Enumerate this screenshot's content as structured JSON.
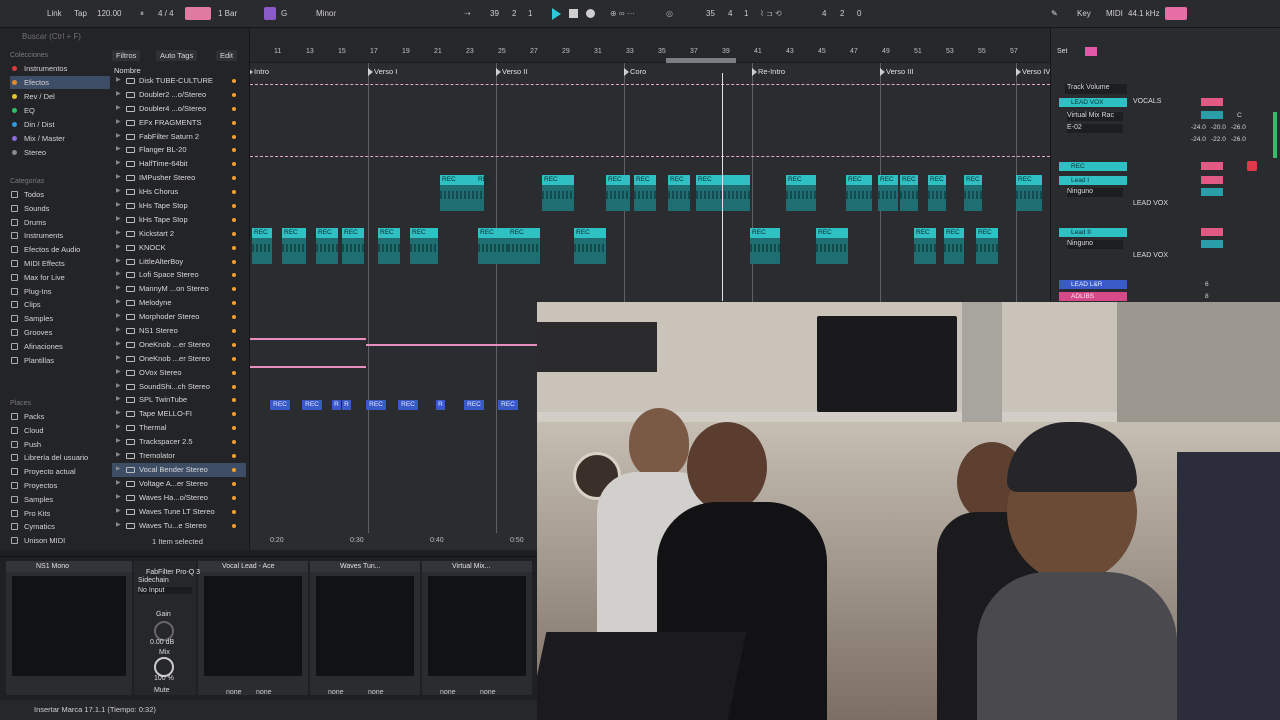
{
  "transport": {
    "link": "Link",
    "tap": "Tap",
    "tempo": "120.00",
    "signature": "4 / 4",
    "quantize": "1 Bar",
    "key_root": "G",
    "scale": "Minor",
    "position_bar": "39",
    "position_beat": "2",
    "position_sixteenth": "1",
    "loop_start_bar": "35",
    "loop_start_beat": "4",
    "loop_start_sixteenth": "1",
    "loop_length_bar": "4",
    "loop_length_beat": "2",
    "loop_length_sixteenth": "0",
    "key_label": "Key",
    "midi_label": "MIDI",
    "sample_rate": "44.1 kHz"
  },
  "browser": {
    "search_placeholder": "Buscar (Ctrl + F)",
    "colecciones_label": "Colecciones",
    "collections": [
      {
        "label": "Instrumentos",
        "color": "#e23a3a"
      },
      {
        "label": "Efectos",
        "color": "#e5882a"
      },
      {
        "label": "Rev / Del",
        "color": "#e5c52a"
      },
      {
        "label": "EQ",
        "color": "#2fbf6a"
      },
      {
        "label": "Din / Dist",
        "color": "#2a9be0"
      },
      {
        "label": "Mix / Master",
        "color": "#8a6ae0"
      },
      {
        "label": "Stereo",
        "color": "#8a8a8a"
      }
    ],
    "categorias_label": "Categorías",
    "categories": [
      "Todos",
      "Sounds",
      "Drums",
      "Instruments",
      "Efectos de Audio",
      "MIDI Effects",
      "Max for Live",
      "Plug-Ins",
      "Clips",
      "Samples",
      "Grooves",
      "Afinaciones",
      "Plantillas"
    ],
    "places_label": "Places",
    "places": [
      "Packs",
      "Cloud",
      "Push",
      "Librería del usuario",
      "Proyecto actual",
      "Proyectos",
      "Samples",
      "Pro Kits",
      "Cymatics",
      "Unison MIDI"
    ],
    "filter_label": "Filtros",
    "auto_tags_label": "Auto Tags",
    "edit_label": "Edit",
    "name_header": "Nombre",
    "files": [
      "Disk TUBE-CULTURE",
      "Doubler2 ...o/Stereo",
      "Doubler4 ...o/Stereo",
      "EFx FRAGMENTS",
      "FabFilter Saturn 2",
      "Flanger BL-20",
      "HalfTime-64bit",
      "IMPusher Stereo",
      "kHs Chorus",
      "kHs Tape Stop",
      "kHs Tape Stop",
      "Kickstart 2",
      "KNOCK",
      "LittleAlterBoy",
      "Lofi Space Stereo",
      "MannyM ...on Stereo",
      "Melodyne",
      "Morphoder Stereo",
      "NS1 Stereo",
      "OneKnob ...er Stereo",
      "OneKnob ...er Stereo",
      "OVox Stereo",
      "SoundShi...ch Stereo",
      "SPL TwinTube",
      "Tape MELLO-FI",
      "Thermal",
      "Trackspacer 2.5",
      "Tremolator",
      "Vocal Bender Stereo",
      "Voltage A...er Stereo",
      "Waves Ha...o/Stereo",
      "Waves Tune LT Stereo",
      "Waves Tu...e Stereo"
    ],
    "selected_file_index": 28,
    "selection_status": "1 Item selected"
  },
  "arrangement": {
    "bar_numbers": [
      "11",
      "13",
      "15",
      "17",
      "19",
      "21",
      "23",
      "25",
      "27",
      "29",
      "31",
      "33",
      "35",
      "37",
      "39",
      "41",
      "43",
      "45",
      "47",
      "49",
      "51",
      "53",
      "55",
      "57"
    ],
    "locators": [
      "Intro",
      "Verso I",
      "Verso II",
      "Coro",
      "Re-Intro",
      "Verso III",
      "Verso IV"
    ],
    "clip_label": "REC",
    "blue_clip_labels": [
      "REC",
      "REC",
      "R",
      "R",
      "REC",
      "REC",
      "R",
      "REC",
      "REC"
    ],
    "timecodes": [
      "0:20",
      "0:30",
      "0:40",
      "0:50"
    ]
  },
  "mixer": {
    "set_label": "Set",
    "track_volume": "Track Volume",
    "tracks": [
      {
        "name": "LEAD VOX",
        "output": "VOCALS",
        "num": "7",
        "vol": "0",
        "pan": "C"
      },
      {
        "name": "REC",
        "num": "3"
      },
      {
        "name": "Lead I",
        "num": "4",
        "vol": "0",
        "pan": "C",
        "input": "Ninguno",
        "output": "LEAD VOX"
      },
      {
        "name": "Lead II",
        "num": "5",
        "vol": "0",
        "pan": "C",
        "input": "Ninguno",
        "output": "LEAD VOX"
      },
      {
        "name": "LEAD L&R",
        "num": "6"
      },
      {
        "name": "ADLIBS",
        "num": "8"
      }
    ],
    "device": "Virtual Mix Rac",
    "preset": "E-02",
    "sends": [
      "-24.0",
      "-20.0",
      "-26.0"
    ],
    "sends_b": [
      "-24.0",
      "-22.0",
      "-26.0"
    ],
    "solo_label": "S"
  },
  "devices": [
    {
      "title": "NS1 Mono",
      "sel1": "",
      "sel2": ""
    },
    {
      "title": "FabFilter Pro-Q 3",
      "sel1": "none",
      "sel2": "none"
    },
    {
      "title": "Waves Tun...",
      "sel1": "none",
      "sel2": "none"
    },
    {
      "title": "Virtual Mix...",
      "sel1": "none",
      "sel2": "none"
    }
  ],
  "chain": {
    "sidechain_label": "Sidechain",
    "sidechain_input": "No Input",
    "gain_label": "Gain",
    "gain_value": "0.00 dB",
    "mix_label": "Mix",
    "mix_value": "100 %",
    "mute_label": "Mute",
    "preset_name": "Vocal Lead - Ace",
    "chain_sel1": "none",
    "chain_sel2": "none"
  },
  "status_message": "Insertar Marca 17.1.1 (Tiempo: 0:32)"
}
